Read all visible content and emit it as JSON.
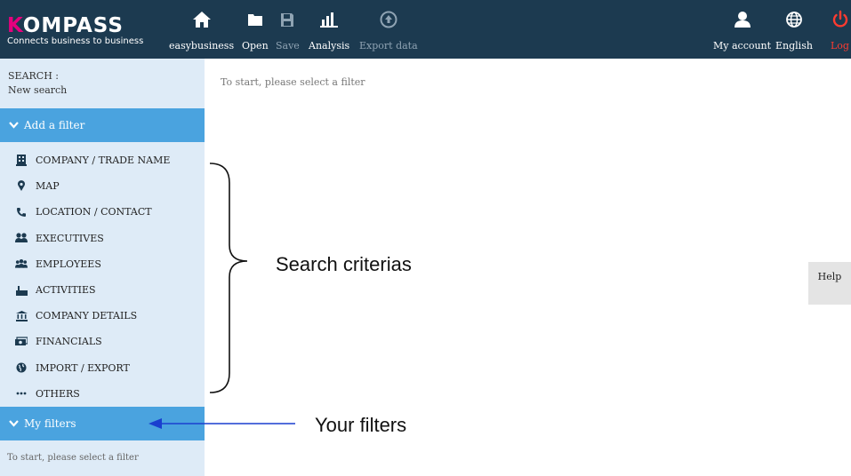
{
  "brand": {
    "logo_k": "K",
    "logo_rest": "OMPASS",
    "tagline": "Connects business to business"
  },
  "topnav": {
    "items": [
      {
        "label": "easybusiness",
        "icon": "home-icon"
      },
      {
        "label": "Open",
        "icon": "folder-icon"
      },
      {
        "label": "Save",
        "icon": "save-icon"
      },
      {
        "label": "Analysis",
        "icon": "bar-chart-icon"
      },
      {
        "label": "Export data",
        "icon": "export-icon"
      }
    ],
    "right": [
      {
        "label": "My account",
        "icon": "user-icon"
      },
      {
        "label": "English",
        "icon": "globe-icon"
      },
      {
        "label": "Log out",
        "icon": "power-icon"
      }
    ]
  },
  "sidebar": {
    "search_label": "SEARCH :",
    "search_value": "New search",
    "add_filter_label": "Add a filter",
    "filters": [
      {
        "label": "COMPANY / TRADE NAME",
        "icon": "building-icon"
      },
      {
        "label": "MAP",
        "icon": "map-marker-icon"
      },
      {
        "label": "LOCATION / CONTACT",
        "icon": "phone-icon"
      },
      {
        "label": "EXECUTIVES",
        "icon": "executives-icon"
      },
      {
        "label": "EMPLOYEES",
        "icon": "employees-icon"
      },
      {
        "label": "ACTIVITIES",
        "icon": "factory-icon"
      },
      {
        "label": "COMPANY DETAILS",
        "icon": "bank-icon"
      },
      {
        "label": "FINANCIALS",
        "icon": "money-icon"
      },
      {
        "label": "IMPORT / EXPORT",
        "icon": "globe-icon"
      },
      {
        "label": "OTHERS",
        "icon": "ellipsis-icon"
      }
    ],
    "my_filters_label": "My filters",
    "my_filters_empty": "To start, please select a filter"
  },
  "main": {
    "hint": "To start, please select a filter",
    "help_label": "Help"
  },
  "annotations": {
    "search_criterias": "Search criterias",
    "your_filters": "Your filters"
  },
  "colors": {
    "topbar": "#1c3a50",
    "sidebar": "#deebf7",
    "section_header": "#4aa3df",
    "logo_accent": "#e6007e",
    "logout": "#ff3b30"
  }
}
